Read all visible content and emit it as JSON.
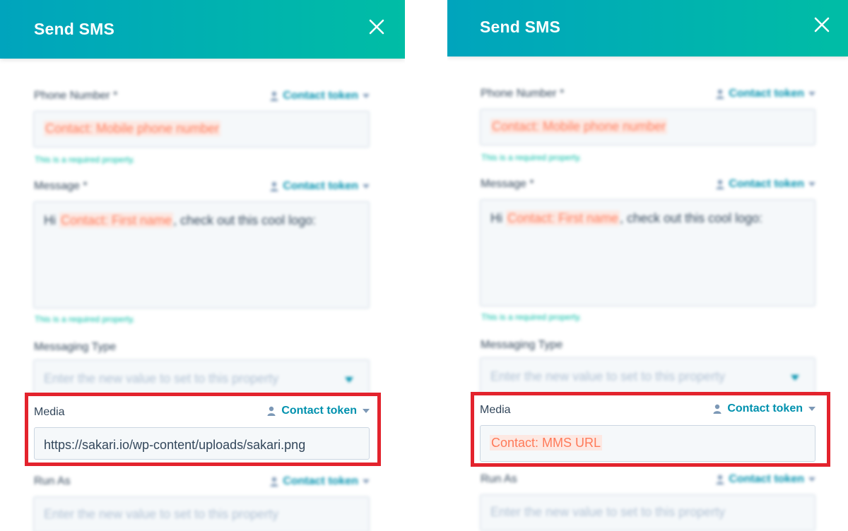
{
  "panels": {
    "left": {
      "title": "Send SMS",
      "phone": {
        "label": "Phone Number *",
        "token": "Contact token",
        "value": "Contact: Mobile phone number",
        "helper": "This is a required property."
      },
      "message": {
        "label": "Message *",
        "token": "Contact token",
        "prefix": "Hi ",
        "token_value": "Contact: First name",
        "suffix": ", check out this cool logo:",
        "helper": "This is a required property."
      },
      "messaging_type": {
        "label": "Messaging Type",
        "placeholder": "Enter the new value to set to this property"
      },
      "media": {
        "label": "Media",
        "token": "Contact token",
        "value": "https://sakari.io/wp-content/uploads/sakari.png"
      },
      "run_as": {
        "label": "Run As",
        "token": "Contact token",
        "placeholder": "Enter the new value to set to this property"
      }
    },
    "right": {
      "title": "Send SMS",
      "phone": {
        "label": "Phone Number *",
        "token": "Contact token",
        "value": "Contact: Mobile phone number",
        "helper": "This is a required property."
      },
      "message": {
        "label": "Message *",
        "token": "Contact token",
        "prefix": "Hi ",
        "token_value": "Contact: First name",
        "suffix": ", check out this cool logo:",
        "helper": "This is a required property."
      },
      "messaging_type": {
        "label": "Messaging Type",
        "placeholder": "Enter the new value to set to this property"
      },
      "media": {
        "label": "Media",
        "token": "Contact token",
        "value": "Contact: MMS URL"
      },
      "run_as": {
        "label": "Run As",
        "token": "Contact token",
        "placeholder": "Enter the new value to set to this property"
      }
    }
  },
  "colors": {
    "header_start": "#00a4bd",
    "header_end": "#00bda5",
    "link": "#0091ae",
    "token_text": "#ff7a59",
    "highlight_border": "#e3232d"
  },
  "icons": [
    "close-icon",
    "contact-person-icon",
    "caret-down-icon"
  ]
}
